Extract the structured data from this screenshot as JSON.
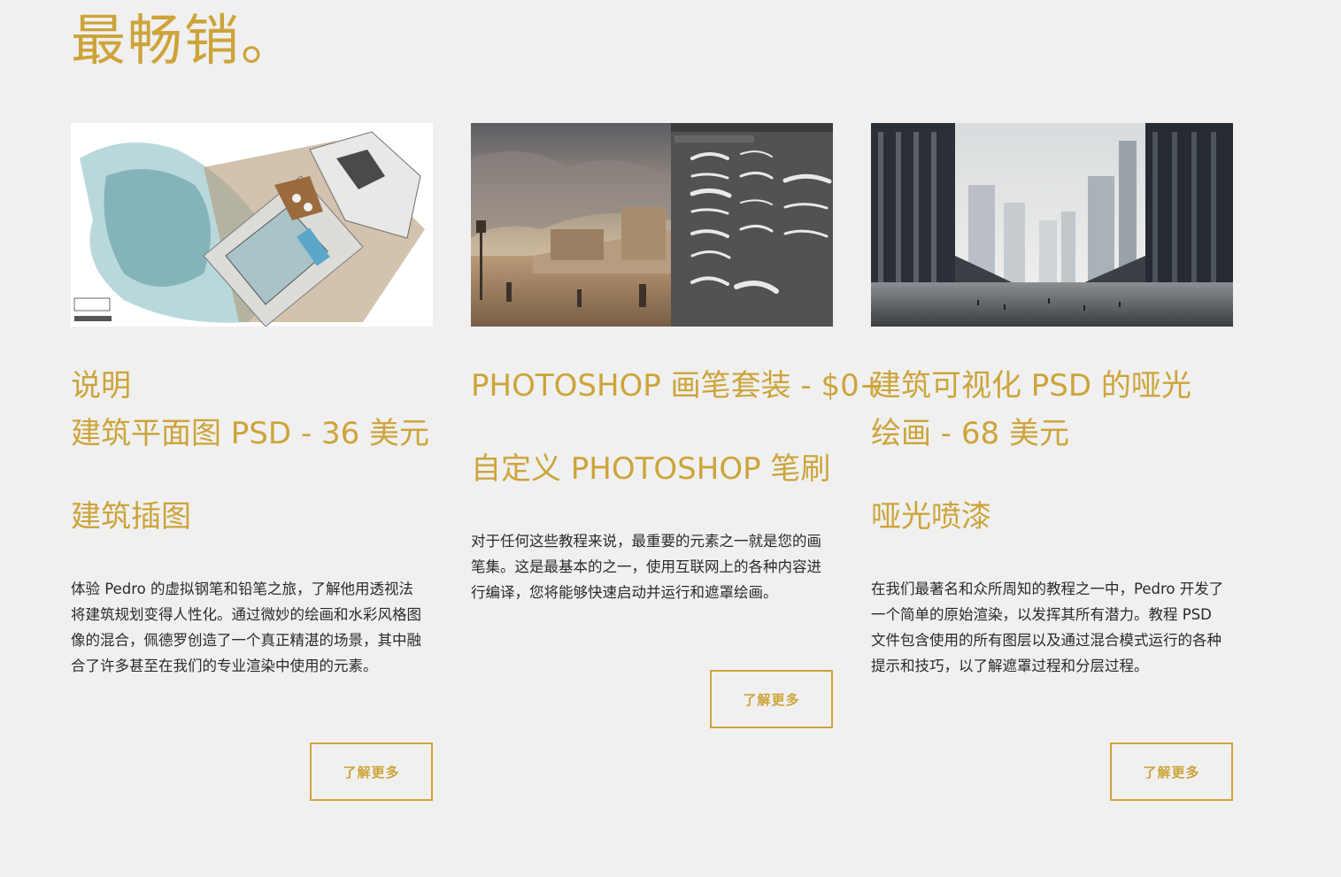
{
  "section": {
    "title": "最畅销。"
  },
  "cards": [
    {
      "image_alt": "architecture plan illustration",
      "title_lines": [
        "说明",
        "建筑平面图 PSD - 36 美元"
      ],
      "subtitle": "建筑插图",
      "description": "体验 Pedro 的虚拟钢笔和铅笔之旅，了解他用透视法将建筑规划变得人性化。通过微妙的绘画和水彩风格图像的混合，佩德罗创造了一个真正精湛的场景，其中融合了许多甚至在我们的专业渲染中使用的元素。",
      "button": "了解更多"
    },
    {
      "image_alt": "photoshop brush set preview",
      "title_lines": [
        "PHOTOSHOP 画笔套装 - $0+"
      ],
      "subtitle": "自定义 PHOTOSHOP 笔刷",
      "description": "对于任何这些教程来说，最重要的元素之一就是您的画笔集。这是最基本的之一，使用互联网上的各种内容进行编译，您将能够快速启动并运行和遮罩绘画。",
      "button": "了解更多"
    },
    {
      "image_alt": "architectural matte painting city",
      "title_lines": [
        "建筑可视化 PSD 的哑光",
        "绘画 - 68 美元"
      ],
      "subtitle": "哑光喷漆",
      "description": "在我们最著名和众所周知的教程之一中，Pedro 开发了一个简单的原始渲染，以发挥其所有潜力。教程 PSD 文件包含使用的所有图层以及通过混合模式运行的各种提示和技巧，以了解遮罩过程和分层过程。",
      "button": "了解更多"
    }
  ],
  "colors": {
    "accent": "#cda43a",
    "background": "#f0f0f0",
    "text": "#2a2a2a"
  }
}
